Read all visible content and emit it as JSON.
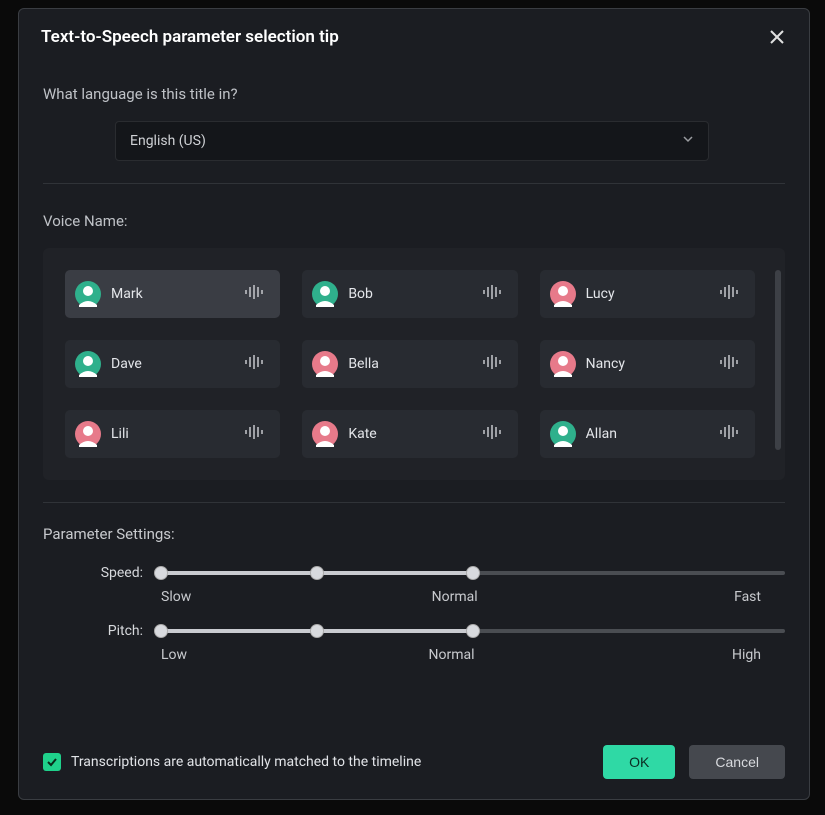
{
  "dialog": {
    "title": "Text-to-Speech parameter selection tip"
  },
  "language": {
    "question": "What language is this title in?",
    "selected": "English (US)"
  },
  "voices_label": "Voice Name:",
  "voices": [
    {
      "name": "Mark",
      "avatar_color": "#2fb08c",
      "selected": true
    },
    {
      "name": "Bob",
      "avatar_color": "#2fb08c",
      "selected": false
    },
    {
      "name": "Lucy",
      "avatar_color": "#e77a8a",
      "selected": false
    },
    {
      "name": "Dave",
      "avatar_color": "#2fb08c",
      "selected": false
    },
    {
      "name": "Bella",
      "avatar_color": "#e77a8a",
      "selected": false
    },
    {
      "name": "Nancy",
      "avatar_color": "#e77a8a",
      "selected": false
    },
    {
      "name": "Lili",
      "avatar_color": "#e77a8a",
      "selected": false
    },
    {
      "name": "Kate",
      "avatar_color": "#e77a8a",
      "selected": false
    },
    {
      "name": "Allan",
      "avatar_color": "#2fb08c",
      "selected": false
    }
  ],
  "params": {
    "heading": "Parameter Settings:",
    "speed": {
      "label": "Speed:",
      "value": 50,
      "ticks": {
        "low": "Slow",
        "mid": "Normal",
        "high": "Fast"
      }
    },
    "pitch": {
      "label": "Pitch:",
      "value": 50,
      "ticks": {
        "low": "Low",
        "mid": "Normal",
        "high": "High"
      }
    }
  },
  "checkbox": {
    "checked": true,
    "label": "Transcriptions are automatically matched to the timeline"
  },
  "buttons": {
    "ok": "OK",
    "cancel": "Cancel"
  }
}
